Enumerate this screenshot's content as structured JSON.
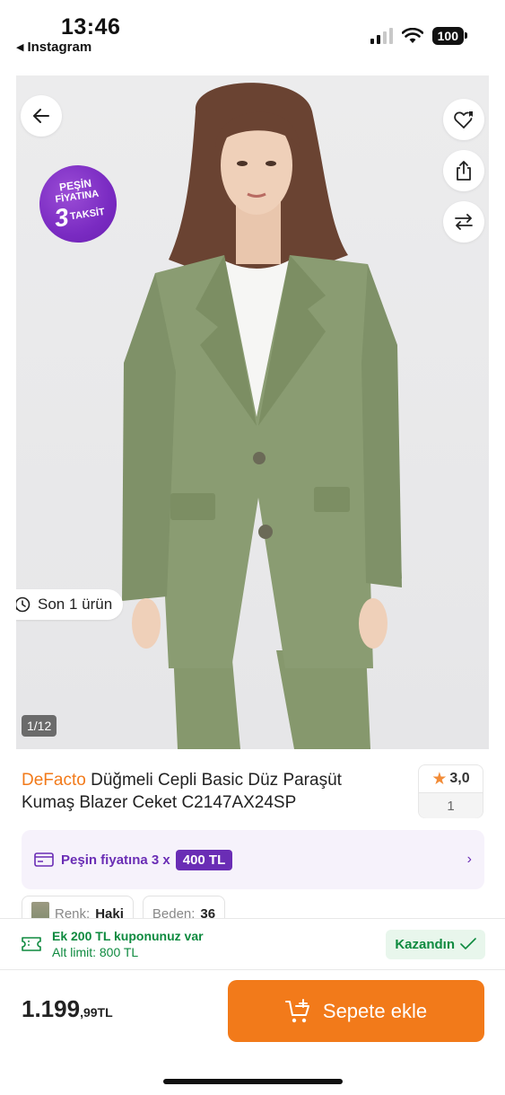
{
  "status_bar": {
    "time": "13:46",
    "back_app": "Instagram",
    "battery": "100"
  },
  "gallery": {
    "promo_badge": {
      "line1": "PEŞİN",
      "line2": "FİYATINA",
      "line3_number": "3",
      "line3_text": "TAKSİT"
    },
    "stock_label": "Son 1 ürün",
    "counter": "1/12",
    "icons": [
      "back-arrow-icon",
      "heart-plus-icon",
      "share-icon",
      "compare-icon"
    ]
  },
  "product": {
    "brand": "DeFacto",
    "name": " Düğmeli Cepli Basic Düz Paraşüt Kumaş Blazer Ceket C2147AX24SP",
    "rating": "3,0",
    "rating_count": "1"
  },
  "installment": {
    "text": "Peşin fiyatına 3 x",
    "amount": "400 TL"
  },
  "variants": [
    {
      "label": "Renk:",
      "value": "Haki"
    },
    {
      "label": "Beden:",
      "value": "36"
    }
  ],
  "coupon": {
    "main": "Ek 200 TL kuponunuz var",
    "sub": "Alt limit: 800 TL",
    "action": "Kazandın"
  },
  "bottom": {
    "price_main": "1.199",
    "price_decimal": ",99TL",
    "add_to_cart": "Sepete ekle"
  },
  "colors": {
    "accent_orange": "#f27a1a",
    "purple": "#6a2db5",
    "green": "#0e8a3f",
    "jacket": "#8a9c72"
  }
}
